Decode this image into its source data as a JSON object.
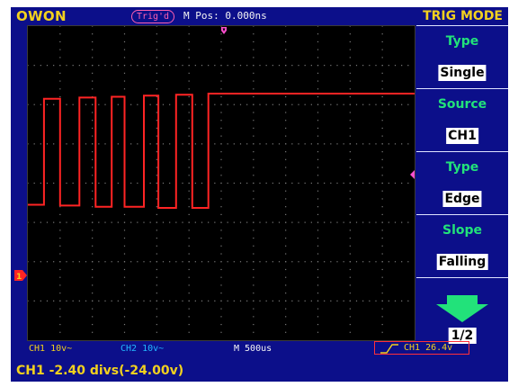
{
  "header": {
    "brand": "OWON",
    "trigger_state": "Trig'd",
    "m_pos": "M Pos: 0.000ns",
    "menu_title": "TRIG MODE"
  },
  "menu": {
    "items": [
      {
        "label": "Type",
        "value": "Single"
      },
      {
        "label": "Source",
        "value": "CH1"
      },
      {
        "label": "Type",
        "value": "Edge"
      },
      {
        "label": "Slope",
        "value": "Falling"
      }
    ],
    "page": "1/2",
    "next_icon": "down-arrow-icon"
  },
  "status": {
    "ch1": "CH1  10v~",
    "ch2": "CH2  10v~",
    "timebase": "M 500us",
    "trigger": "CH1 26.4v"
  },
  "readout": "CH1 -2.40 divs(-24.00v)",
  "colors": {
    "frame": "#0c0f8a",
    "trace": "#ff2424",
    "text_yellow": "#f2d11e",
    "menu_green": "#22e27a",
    "ch2_blue": "#23b8ff"
  },
  "waveform": {
    "type": "square",
    "edges": [
      0.5,
      1.0,
      1.6,
      2.1,
      2.6,
      3.0,
      3.6,
      4.05,
      4.6,
      5.1,
      5.6
    ],
    "low_level": -0.55,
    "high_level": 2.15,
    "high_offsets": [
      0,
      0.03,
      0.05,
      0.08,
      0.1,
      0.13
    ],
    "low_offsets": [
      0,
      -0.02,
      -0.05,
      -0.05,
      -0.08,
      -0.08
    ]
  }
}
